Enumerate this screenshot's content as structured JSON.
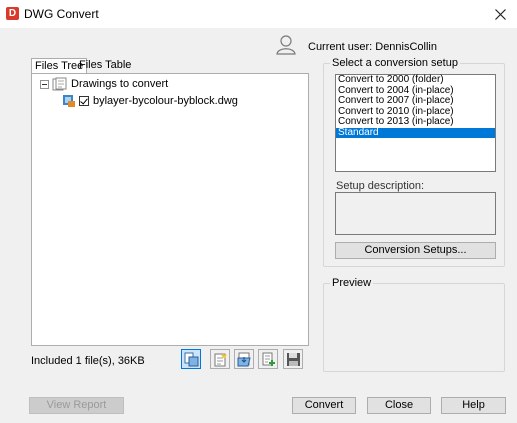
{
  "window": {
    "title": "DWG Convert",
    "app_icon_letter": "D"
  },
  "user": {
    "label": "Current user: DennisCollin"
  },
  "tabs": [
    {
      "label": "Files Tree"
    },
    {
      "label": "Files Table"
    }
  ],
  "tree": {
    "root": "Drawings to convert",
    "file": "bylayer-bycolour-byblock.dwg"
  },
  "status": "Included 1 file(s), 36KB",
  "setup": {
    "group_label": "Select a conversion setup",
    "items": [
      "Convert to 2000 (folder)",
      "Convert to 2004 (in-place)",
      "Convert to 2007 (in-place)",
      "Convert to 2010 (in-place)",
      "Convert to 2013 (in-place)",
      "Standard"
    ],
    "description_label": "Setup description:",
    "setups_button": "Conversion Setups..."
  },
  "preview": {
    "label": "Preview"
  },
  "buttons": {
    "view_report": "View Report",
    "convert": "Convert",
    "close": "Close",
    "help": "Help"
  },
  "colors": {
    "selection": "#0078d7",
    "app_icon": "#d83b2c"
  }
}
